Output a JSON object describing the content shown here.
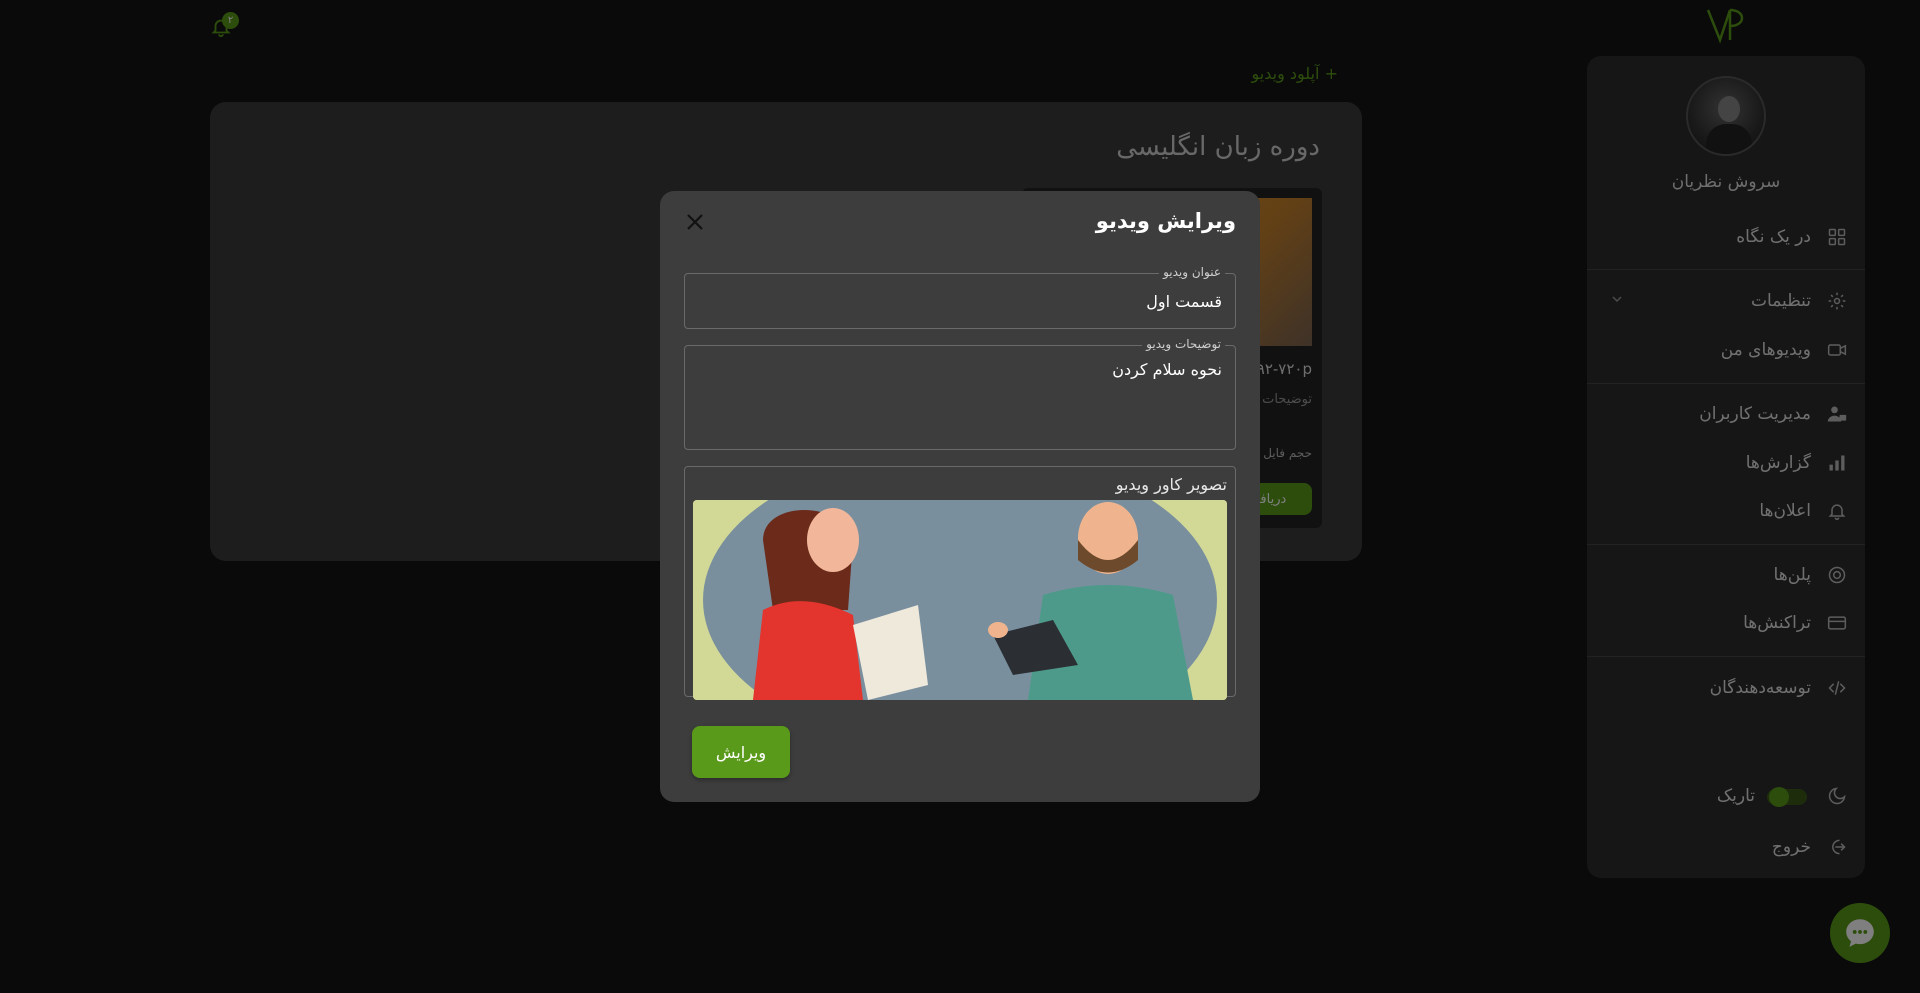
{
  "header": {
    "notification_count": "۲",
    "upload_label": "+ آپلود ویدیو"
  },
  "course": {
    "title": "دوره زبان انگلیسی",
    "video_card": {
      "quality": "۶۹۲-۷۲۰p",
      "description_label": "توضیحات",
      "size_label": "حجم فایل",
      "download_label": "دریافت"
    }
  },
  "sidebar": {
    "user_name": "سروش نظریان",
    "items": [
      {
        "label": "در یک نگاه",
        "icon": "grid-icon"
      },
      {
        "label": "تنظیمات",
        "icon": "gear-icon"
      },
      {
        "label": "ویدیوهای من",
        "icon": "video-icon"
      },
      {
        "label": "مدیریت کاربران",
        "icon": "users-lock-icon"
      },
      {
        "label": "گزارش‌ها",
        "icon": "bar-chart-icon"
      },
      {
        "label": "اعلان‌ها",
        "icon": "bell-icon"
      },
      {
        "label": "پلن‌ها",
        "icon": "plans-icon"
      },
      {
        "label": "تراکنش‌ها",
        "icon": "credit-card-icon"
      },
      {
        "label": "توسعه‌دهندگان",
        "icon": "code-icon"
      }
    ],
    "theme_label": "تاریک",
    "logout_label": "خروج"
  },
  "modal": {
    "title": "ویرایش ویدیو",
    "title_field": {
      "legend": "عنوان ویدیو",
      "value": "قسمت اول"
    },
    "description_field": {
      "legend": "توضیحات ویدیو",
      "value": "نحوه سلام کردن"
    },
    "cover_label": "تصویر کاور ویدیو",
    "submit_label": "ویرایش"
  },
  "colors": {
    "accent": "#5a9a1a",
    "background": "#151515",
    "modal": "#3d3d3d",
    "sidebar": "#2d2d2d"
  }
}
